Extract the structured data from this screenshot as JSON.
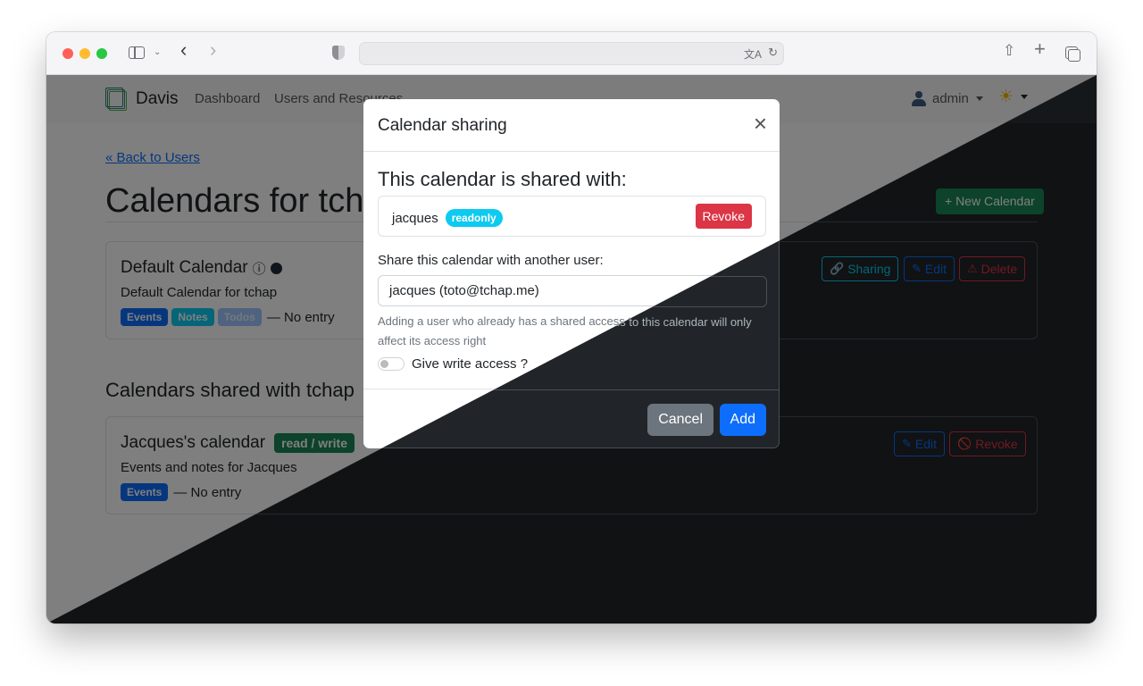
{
  "browser": {
    "icons": {
      "sidebar": "sidebar-icon",
      "back": "‹",
      "forward": "›",
      "translate": "文A",
      "reload": "↻",
      "share": "⇧",
      "new_tab": "+",
      "tabs": "tabs-icon"
    }
  },
  "navbar": {
    "brand": "Davis",
    "links": [
      "Dashboard",
      "Users and Resources"
    ],
    "user": "admin",
    "theme_icon": "☀"
  },
  "page": {
    "back_link": "« Back to Users",
    "title": "Calendars for tchap",
    "new_calendar_button": "+ New Calendar",
    "own_calendars": [
      {
        "name": "Default Calendar",
        "info_icon": "ⓘ",
        "color": "#1e2a3a",
        "description": "Default Calendar for tchap",
        "tags": [
          "Events",
          "Notes",
          "Todos"
        ],
        "entries": "— No entry",
        "actions": {
          "sharing": "Sharing",
          "edit": "Edit",
          "delete": "Delete"
        }
      }
    ],
    "shared_section_title": "Calendars shared with tchap",
    "shared_calendars": [
      {
        "name": "Jacques's calendar",
        "access_badge": "read / write",
        "description": "Events and notes for Jacques",
        "tags": [
          "Events"
        ],
        "entries": "— No entry",
        "actions": {
          "edit": "Edit",
          "revoke": "Revoke"
        }
      }
    ]
  },
  "modal": {
    "title": "Calendar sharing",
    "close_icon": "×",
    "shared_heading": "This calendar is shared with:",
    "shares": [
      {
        "user": "jacques",
        "access": "readonly",
        "revoke_label": "Revoke"
      }
    ],
    "share_label": "Share this calendar with another user:",
    "selected_user": "jacques (toto@tchap.me)",
    "help_text": "Adding a user who already has a shared access to this calendar will only affect its access right",
    "write_access_label": "Give write access ?",
    "write_access_enabled": false,
    "cancel_label": "Cancel",
    "add_label": "Add"
  },
  "colors": {
    "primary": "#0d6efd",
    "success": "#198754",
    "danger": "#dc3545",
    "info": "#0dcaf0",
    "secondary": "#6c757d"
  }
}
